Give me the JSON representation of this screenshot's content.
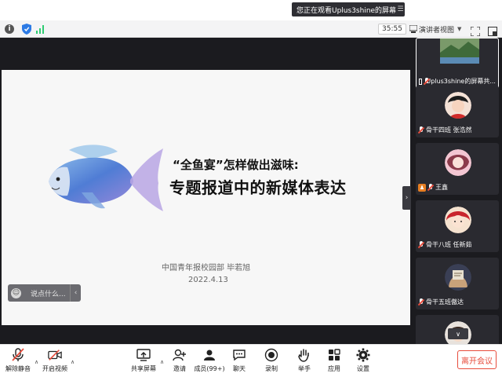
{
  "banner": {
    "text": "您正在观看Uplus3shine的屏幕"
  },
  "info_bar": {
    "timer": "35:55",
    "view_mode": "演讲者视图"
  },
  "slide": {
    "title_line1": "“全鱼宴”怎样做出滋味:",
    "title_line2": "专题报道中的新媒体表达",
    "author": "中国青年报校园部   毕若旭",
    "date": "2022.4.13"
  },
  "chat": {
    "placeholder": "说点什么..."
  },
  "participants": [
    {
      "name": "Uplus3shine的屏幕共...",
      "kind": "screen",
      "active": true
    },
    {
      "name": "骨干四班 张浩然",
      "kind": "muted"
    },
    {
      "name": "王鑫",
      "kind": "host"
    },
    {
      "name": "骨干八班 任新茹",
      "kind": "muted"
    },
    {
      "name": "骨干五班傲达",
      "kind": "muted"
    }
  ],
  "toolbar": {
    "unmute": "解除静音",
    "start_video": "开启视频",
    "share_screen": "共享屏幕",
    "invite": "邀请",
    "members": "成员(99+)",
    "chat": "聊天",
    "record": "录制",
    "raise_hand": "举手",
    "apps": "应用",
    "settings": "设置",
    "leave": "离开会议"
  },
  "colors": {
    "accent_red": "#e74c3c",
    "canvas": "#1b1b1f",
    "toolbar_bg": "#ffffff"
  }
}
